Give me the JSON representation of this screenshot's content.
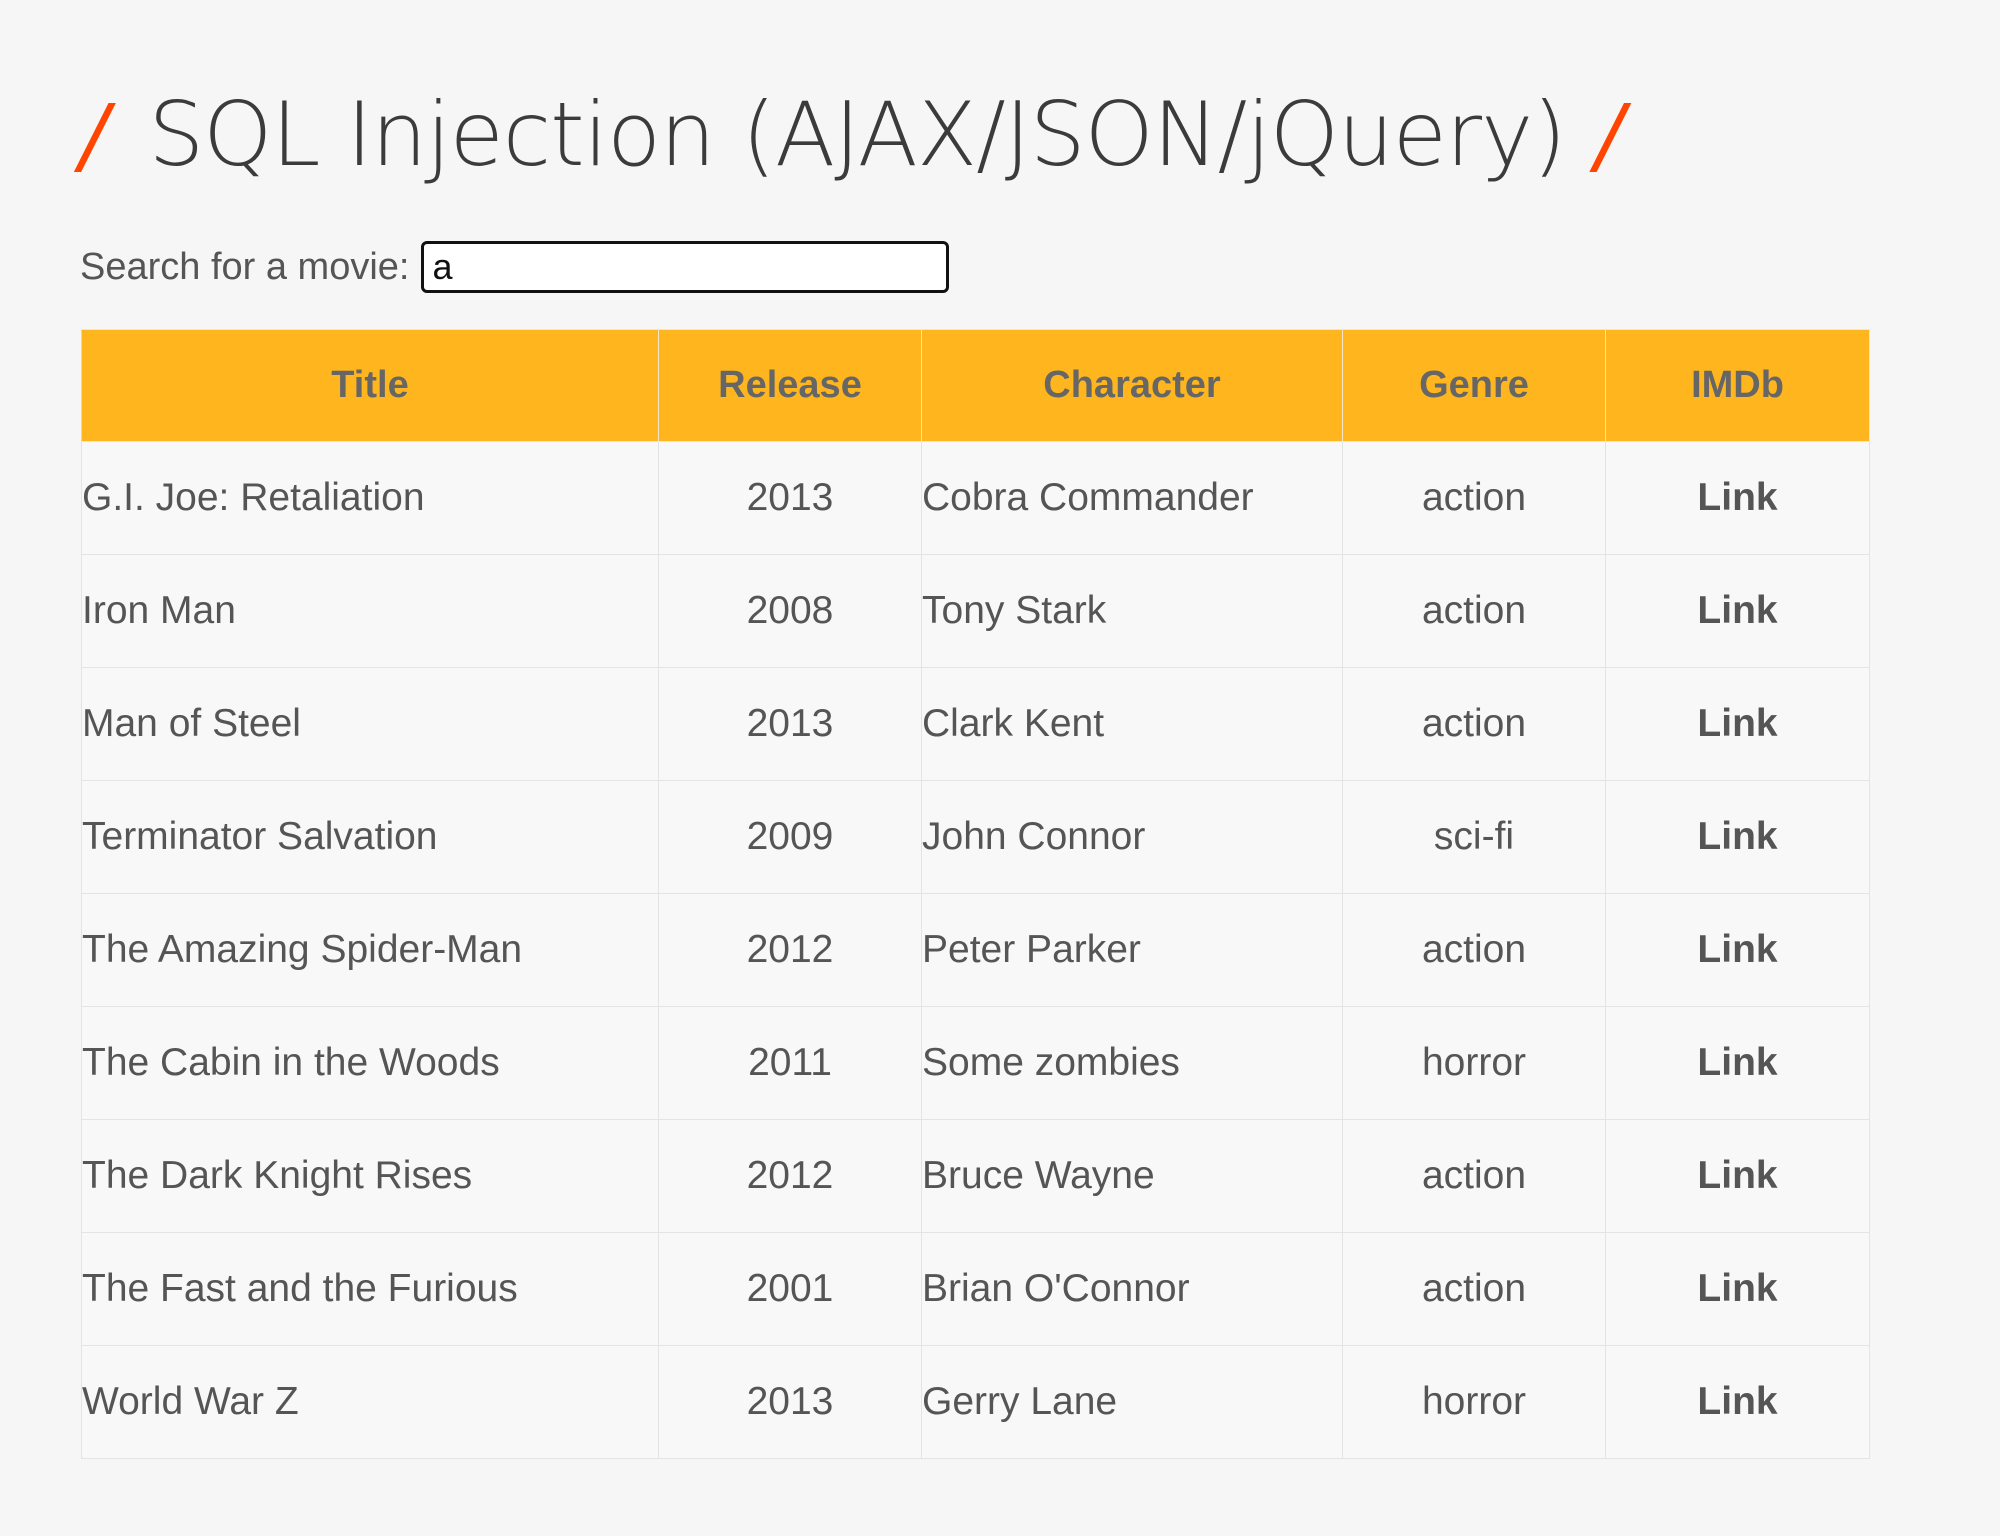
{
  "page": {
    "title": "SQL Injection (AJAX/JSON/jQuery)",
    "title_slash": "/"
  },
  "search": {
    "label": "Search for a movie:",
    "value": "a"
  },
  "table": {
    "headers": [
      "Title",
      "Release",
      "Character",
      "Genre",
      "IMDb"
    ],
    "rows": [
      {
        "title": "G.I. Joe: Retaliation",
        "release": "2013",
        "character": "Cobra Commander",
        "genre": "action",
        "imdb": "Link"
      },
      {
        "title": "Iron Man",
        "release": "2008",
        "character": "Tony Stark",
        "genre": "action",
        "imdb": "Link"
      },
      {
        "title": "Man of Steel",
        "release": "2013",
        "character": "Clark Kent",
        "genre": "action",
        "imdb": "Link"
      },
      {
        "title": "Terminator Salvation",
        "release": "2009",
        "character": "John Connor",
        "genre": "sci-fi",
        "imdb": "Link"
      },
      {
        "title": "The Amazing Spider-Man",
        "release": "2012",
        "character": "Peter Parker",
        "genre": "action",
        "imdb": "Link"
      },
      {
        "title": "The Cabin in the Woods",
        "release": "2011",
        "character": "Some zombies",
        "genre": "horror",
        "imdb": "Link"
      },
      {
        "title": "The Dark Knight Rises",
        "release": "2012",
        "character": "Bruce Wayne",
        "genre": "action",
        "imdb": "Link"
      },
      {
        "title": "The Fast and the Furious",
        "release": "2001",
        "character": "Brian O'Connor",
        "genre": "action",
        "imdb": "Link"
      },
      {
        "title": "World War Z",
        "release": "2013",
        "character": "Gerry Lane",
        "genre": "horror",
        "imdb": "Link"
      }
    ]
  },
  "colors": {
    "header_bg": "#ffb61e",
    "title_slash": "#ff4500",
    "text": "#555555",
    "background": "#f6f6f6"
  }
}
